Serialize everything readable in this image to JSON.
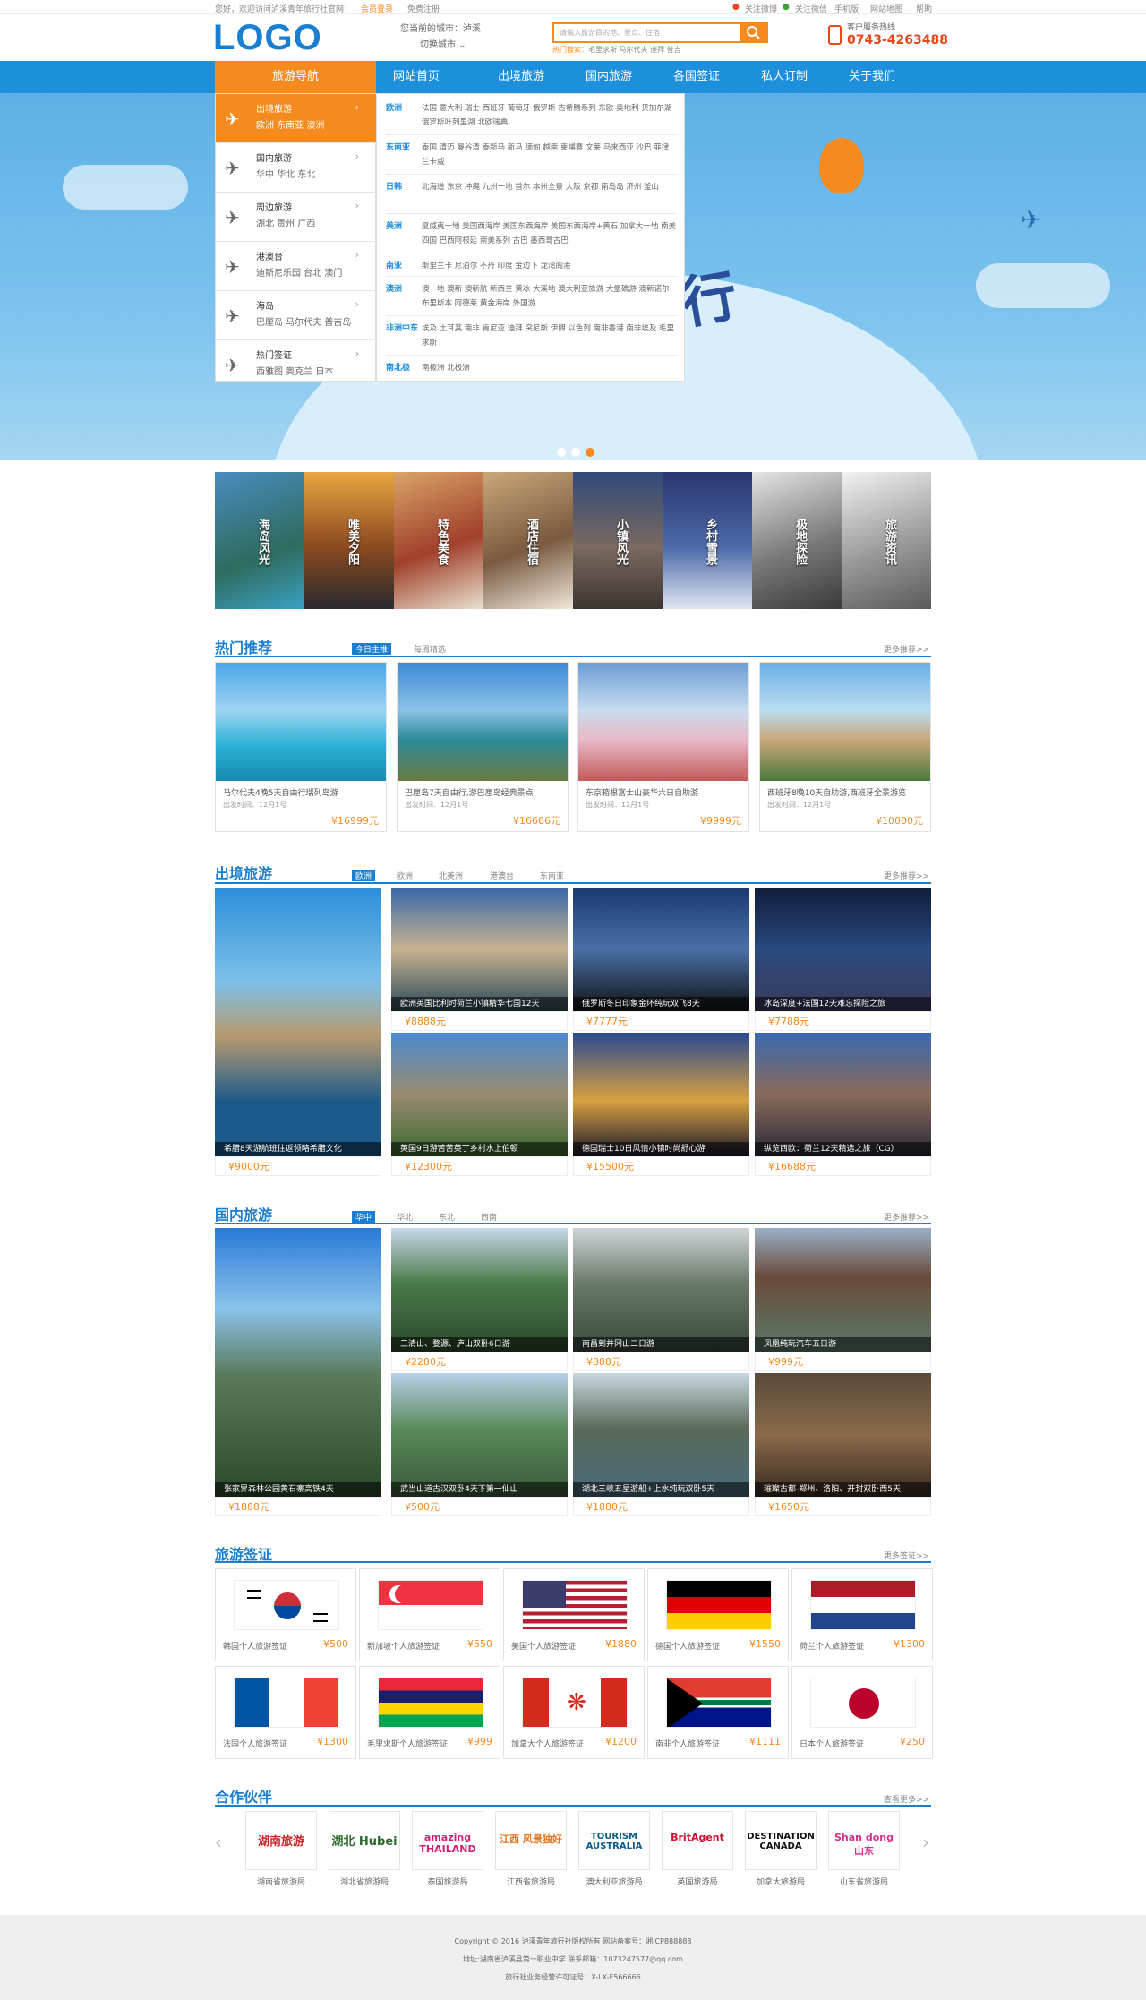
{
  "topbar": {
    "greeting": "您好，欢迎访问泸溪青年旅行社官网！",
    "login": "会员登录",
    "register": "免费注册",
    "follow_weibo": "关注微博",
    "follow_wechat": "关注微信",
    "mobile": "手机版",
    "sitemap": "网站地图",
    "help": "帮助"
  },
  "header": {
    "logo": "LOGO",
    "city_label": "您当前的城市：泸溪",
    "switch_city": "切换城市",
    "search_placeholder": "请输入旅游目的地、景点、住宿",
    "hot_label": "热门搜索：",
    "hot_terms": "毛里求斯  马尔代夫  迪拜  普吉",
    "hotline_label": "客户服务热线",
    "hotline_number": "0743-4263488"
  },
  "nav": {
    "guide": "旅游导航",
    "items": [
      "网站首页",
      "出境旅游",
      "国内旅游",
      "各国签证",
      "私人订制",
      "关于我们"
    ]
  },
  "side_menu": [
    {
      "title": "出境旅游",
      "subs": "欧洲   东南亚   澳洲"
    },
    {
      "title": "国内旅游",
      "subs": "华中   华北   东北"
    },
    {
      "title": "周边旅游",
      "subs": "湖北   贵州   广西"
    },
    {
      "title": "港澳台",
      "subs": "迪斯尼乐园  台北  澳门"
    },
    {
      "title": "海岛",
      "subs": "巴厘岛   马尔代夫   普吉岛"
    },
    {
      "title": "热门签证",
      "subs": "西雅图   奥克兰   日本"
    }
  ],
  "mega_panel": [
    {
      "region": "欧洲",
      "cities": "法国  意大利  瑞士  西班牙  葡萄牙  俄罗斯  古希腊系列  东欧  奥地利  贝加尔湖  俄罗斯叶列里湖  北欧瑞典"
    },
    {
      "region": "东南亚",
      "cities": "泰国  清迈  曼谷清  泰新马  新马  缅甸  越南  柬埔寨  文莱  马来西亚  沙巴  菲律  兰卡威"
    },
    {
      "region": "日韩",
      "cities": "北海道  东京  冲绳  九州一地  首尔  本州全景  大阪  京都  南岛岛  济州  釜山"
    },
    {
      "region": "美洲",
      "cities": "夏威夷一地  美国西海岸  美国东西海岸  美国东西海岸+黄石  加拿大一地  南美四国  巴西阿根廷  南美系列  古巴  墨西哥古巴"
    },
    {
      "region": "南亚",
      "cities": "斯里兰卡  尼泊尔  不丹  印度  金边下  龙湾阁港"
    },
    {
      "region": "澳洲",
      "cities": "澳一地  澳新  澳新航  新西兰  黄冰  大溪地  澳大利亚旅游  大堡礁游  澳新诺尔  布里斯本  阿德莱  黄金海岸  外国游"
    },
    {
      "region": "非洲中东",
      "cities": "埃及  土耳其  南非  肯尼亚  迪拜  突尼斯  伊朗  以色列  南非香港  南非埃及  毛里求斯"
    },
    {
      "region": "南北极",
      "cities": "南极洲  北极洲"
    }
  ],
  "categories": [
    "海岛风光",
    "唯美夕阳",
    "特色美食",
    "酒店住宿",
    "小镇风光",
    "乡村雪景",
    "极地探险",
    "旅游资讯"
  ],
  "hot_section": {
    "title": "热门推荐",
    "tabs": [
      "今日主推",
      "每周精选"
    ],
    "more": "更多推荐>>",
    "cards": [
      {
        "title": "马尔代夫4晚5天自由行瑞列岛游",
        "date": "出发时间：12月1号",
        "price": "¥16999元"
      },
      {
        "title": "巴厘岛7天自由行,游巴厘岛经典景点",
        "date": "出发时间：12月1号",
        "price": "¥16666元"
      },
      {
        "title": "东京箱根富士山豪华六日自助游",
        "date": "出发时间：12月1号",
        "price": "¥9999元"
      },
      {
        "title": "西班牙8晚10天自助游,西班牙全景游览",
        "date": "出发时间：12月1号",
        "price": "¥10000元"
      }
    ]
  },
  "outbound": {
    "title": "出境旅游",
    "tabs": [
      "欧洲",
      "欧洲",
      "北美洲",
      "港澳台",
      "东南亚"
    ],
    "more": "更多推荐>>",
    "feature": {
      "caption": "希腊8天游航班往返领略希腊文化",
      "price": "¥9000元"
    },
    "items": [
      {
        "caption": "欧洲英国比利时荷兰小镇精华七国12天",
        "price": "¥8888元"
      },
      {
        "caption": "俄罗斯冬日印象金环纯玩双飞8天",
        "price": "¥7777元"
      },
      {
        "caption": "冰岛深度+法国12天难忘探险之旅",
        "price": "¥7788元"
      },
      {
        "caption": "英国9日游苦苦英丁乡村水上伯顿",
        "price": "¥12300元"
      },
      {
        "caption": "德国瑞士10日风情小镇时尚舒心游",
        "price": "¥15500元"
      },
      {
        "caption": "纵览西欧：荷兰12天精选之旅（CG）",
        "price": "¥16688元"
      }
    ]
  },
  "domestic": {
    "title": "国内旅游",
    "tabs": [
      "华中",
      "华北",
      "东北",
      "西南"
    ],
    "more": "更多推荐>>",
    "feature": {
      "caption": "张家界森林公园黄石寨高铁4天",
      "price": "¥1888元"
    },
    "items": [
      {
        "caption": "三清山、婺源、庐山双卧6日游",
        "price": "¥2280元"
      },
      {
        "caption": "南昌到井冈山二日游",
        "price": "¥888元"
      },
      {
        "caption": "凤凰纯玩汽车五日游",
        "price": "¥999元"
      },
      {
        "caption": "武当山道古汉双卧4天下第一仙山",
        "price": "¥500元"
      },
      {
        "caption": "湖北三峡五星游船+上水纯玩双卧5天",
        "price": "¥1880元"
      },
      {
        "caption": "璀璨古都-郑州、洛阳、开封双卧西5天",
        "price": "¥1650元"
      }
    ]
  },
  "visa": {
    "title": "旅游签证",
    "more": "更多签证>>",
    "items": [
      {
        "name": "韩国个人旅游签证",
        "price": "¥500",
        "flag": "korea"
      },
      {
        "name": "新加坡个人旅游签证",
        "price": "¥550",
        "flag": "singapore"
      },
      {
        "name": "美国个人旅游签证",
        "price": "¥1880",
        "flag": "usa"
      },
      {
        "name": "德国个人旅游签证",
        "price": "¥1550",
        "flag": "germany"
      },
      {
        "name": "荷兰个人旅游签证",
        "price": "¥1300",
        "flag": "netherlands"
      },
      {
        "name": "法国个人旅游签证",
        "price": "¥1300",
        "flag": "france"
      },
      {
        "name": "毛里求斯个人旅游签证",
        "price": "¥999",
        "flag": "mauritius"
      },
      {
        "name": "加拿大个人旅游签证",
        "price": "¥1200",
        "flag": "canada"
      },
      {
        "name": "南非个人旅游签证",
        "price": "¥1111",
        "flag": "southafrica"
      },
      {
        "name": "日本个人旅游签证",
        "price": "¥250",
        "flag": "japan"
      }
    ]
  },
  "partners": {
    "title": "合作伙伴",
    "more": "查看更多>>",
    "items": [
      {
        "logo": "湖南旅游",
        "name": "湖南省旅游局"
      },
      {
        "logo": "湖北 Hubei",
        "name": "湖北省旅游局"
      },
      {
        "logo": "amazing THAILAND",
        "name": "泰国旅游局"
      },
      {
        "logo": "江西 风景独好",
        "name": "江西省旅游局"
      },
      {
        "logo": "TOURISM AUSTRALIA",
        "name": "澳大利亚旅游局"
      },
      {
        "logo": "BritAgent",
        "name": "英国旅游局"
      },
      {
        "logo": "DESTINATION CANADA",
        "name": "加拿大旅游局"
      },
      {
        "logo": "Shan dong 山东",
        "name": "山东省旅游局"
      }
    ]
  },
  "footer": {
    "line1": "Copyright © 2016 泸溪青年旅行社版权所有   网站备案号：湘ICP888888",
    "line2": "地址:湖南省泸溪县第一职业中学   联系邮箱：1073247577@qq.com",
    "line3": "旅行社业务经营许可证号：X-LX-F566666"
  }
}
